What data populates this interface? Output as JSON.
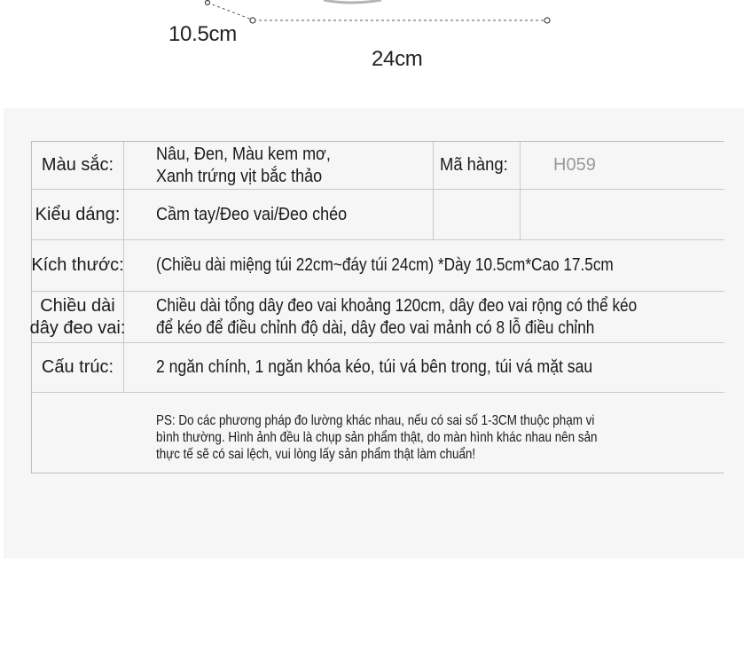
{
  "dimensions": {
    "depth_label": "10.5cm",
    "width_label": "24cm"
  },
  "table": {
    "color_label": "Màu sắc:",
    "color_value_line1": "Nâu, Đen, Màu kem mơ,",
    "color_value_line2": "Xanh trứng vịt bắc thảo",
    "code_label": "Mã hàng:",
    "code_value": "H059",
    "style_label": "Kiểu dáng:",
    "style_value": "Cầm tay/Đeo vai/Đeo chéo",
    "size_label": "Kích thước:",
    "size_value": "(Chiều dài miệng túi 22cm~đáy túi 24cm) *Dày 10.5cm*Cao 17.5cm",
    "strap_label_line1": "Chiều dài",
    "strap_label_line2": "dây đeo vai:",
    "strap_value_line1": "Chiều dài tổng dây đeo vai khoảng 120cm, dây đeo vai rộng có thể kéo",
    "strap_value_line2": "để kéo để điều chỉnh độ dài, dây đeo vai mảnh có 8 lỗ điều chỉnh",
    "structure_label": "Cấu trúc:",
    "structure_value": "2 ngăn chính, 1 ngăn khóa kéo, túi vá bên trong, túi vá mặt sau",
    "note_line1": "PS: Do các phương pháp đo lường khác nhau, nếu có sai số 1-3CM thuộc phạm vi",
    "note_line2": "bình thường. Hình ảnh đều là chụp sản phẩm thật, do màn hình khác nhau nên sản",
    "note_line3": "thực tế sẽ có sai lệch, vui lòng lấy sản phẩm thật làm chuẩn!"
  }
}
